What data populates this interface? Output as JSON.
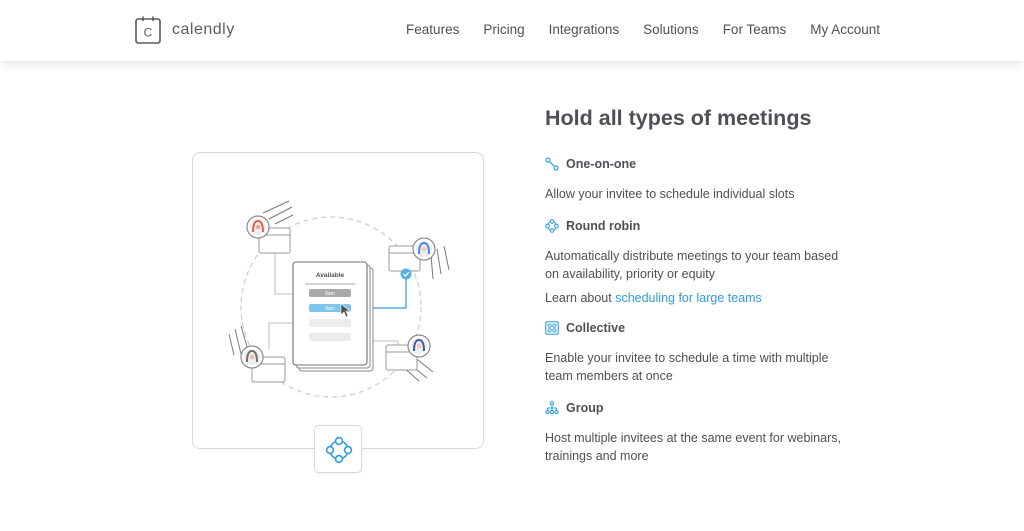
{
  "brand": {
    "name": "calendly",
    "logo_letter": "C"
  },
  "nav": {
    "items": [
      "Features",
      "Pricing",
      "Integrations",
      "Solutions",
      "For Teams",
      "My Account"
    ]
  },
  "illustration": {
    "card_heading": "Available",
    "slot_labels": [
      "8am",
      "9am"
    ]
  },
  "section": {
    "title": "Hold all types of meetings",
    "features": [
      {
        "icon": "one-on-one-icon",
        "title": "One-on-one",
        "description": "Allow your invitee to schedule individual slots"
      },
      {
        "icon": "round-robin-icon",
        "title": "Round robin",
        "description": "Automatically distribute meetings to your team based on availability, priority or equity",
        "link_prefix": "Learn about ",
        "link_text": "scheduling for large teams"
      },
      {
        "icon": "collective-icon",
        "title": "Collective",
        "description": "Enable your invitee to schedule a time with multiple team members at once"
      },
      {
        "icon": "group-icon",
        "title": "Group",
        "description": "Host multiple invitees at the same event for webinars, trainings and more"
      }
    ]
  },
  "colors": {
    "accent": "#2f9de0",
    "text": "#4d5055",
    "border": "#dadada",
    "avatar_red": "#e0614f",
    "avatar_blue": "#4a86e8"
  }
}
